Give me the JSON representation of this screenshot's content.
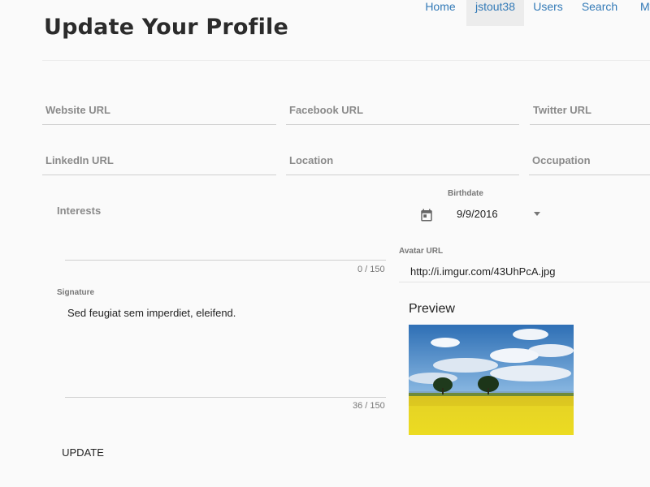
{
  "nav": {
    "home": "Home",
    "user": "jstout38",
    "users": "Users",
    "search": "Search",
    "my": "My"
  },
  "page_title": "Update Your Profile",
  "fields": {
    "website": "Website URL",
    "facebook": "Facebook URL",
    "twitter": "Twitter URL",
    "linkedin": "LinkedIn URL",
    "location": "Location",
    "occupation": "Occupation",
    "interests": "Interests",
    "interests_counter": "0 / 150",
    "birthdate_label": "Birthdate",
    "birthdate_value": "9/9/2016",
    "avatar_label": "Avatar URL",
    "avatar_value": "http://i.imgur.com/43UhPcA.jpg",
    "signature_label": "Signature",
    "signature_value": "Sed feugiat sem imperdiet, eleifend.",
    "signature_counter": "36 / 150"
  },
  "preview": {
    "title": "Preview"
  },
  "actions": {
    "update": "UPDATE"
  },
  "icons": {
    "calendar": "calendar-icon",
    "dropdown": "chevron-down-icon"
  },
  "colors": {
    "link": "#337ab7",
    "active_tab_bg": "#ececec",
    "field_line": "#cfcfcf"
  }
}
